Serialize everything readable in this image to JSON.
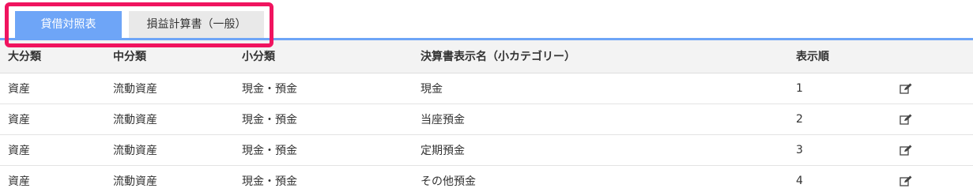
{
  "tabs": [
    {
      "label": "貸借対照表",
      "active": true
    },
    {
      "label": "損益計算書（一般）",
      "active": false
    }
  ],
  "table": {
    "headers": [
      "大分類",
      "中分類",
      "小分類",
      "決算書表示名（小カテゴリー）",
      "表示順",
      ""
    ],
    "rows": [
      {
        "major": "資産",
        "middle": "流動資産",
        "minor": "現金・預金",
        "display_name": "現金",
        "order": "1",
        "action_icon": "edit-icon"
      },
      {
        "major": "資産",
        "middle": "流動資産",
        "minor": "現金・預金",
        "display_name": "当座預金",
        "order": "2",
        "action_icon": "edit-icon"
      },
      {
        "major": "資産",
        "middle": "流動資産",
        "minor": "現金・預金",
        "display_name": "定期預金",
        "order": "3",
        "action_icon": "edit-icon"
      },
      {
        "major": "資産",
        "middle": "流動資産",
        "minor": "現金・預金",
        "display_name": "その他預金",
        "order": "4",
        "action_icon": "edit-icon"
      }
    ]
  },
  "colors": {
    "accent": "#6ea5f7",
    "highlight": "#f0145f",
    "header_bg": "#f3f3f3"
  }
}
